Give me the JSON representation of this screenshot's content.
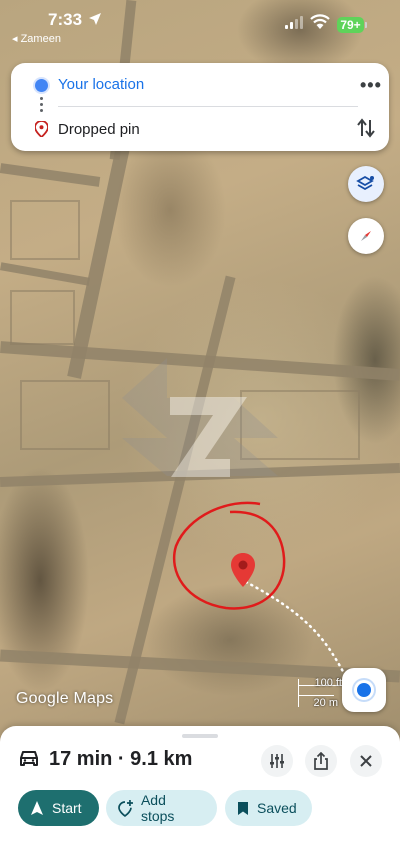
{
  "status_bar": {
    "time": "7:33",
    "back_label": "◂ Zameen",
    "battery": "79+"
  },
  "route": {
    "origin": "Your location",
    "destination": "Dropped pin"
  },
  "map": {
    "logo": "Google Maps",
    "scale_imperial": "100 ft",
    "scale_metric": "20 m",
    "pin_color": "#e53935",
    "annotation_color": "#e01b1b",
    "route_color": "#ffffff"
  },
  "sheet": {
    "summary": "17 min · 9.1 km",
    "start_label": "Start",
    "add_stops_label": "Add stops",
    "saved_label": "Saved"
  },
  "icons": [
    "location-arrow-icon",
    "signal-icon",
    "wifi-icon",
    "battery-icon",
    "origin-dot-icon",
    "pin-icon",
    "more-icon",
    "swap-icon",
    "layers-icon",
    "compass-icon",
    "my-location-icon",
    "car-icon",
    "options-icon",
    "share-icon",
    "close-icon",
    "navigation-icon",
    "add-stop-icon",
    "bookmark-icon"
  ]
}
